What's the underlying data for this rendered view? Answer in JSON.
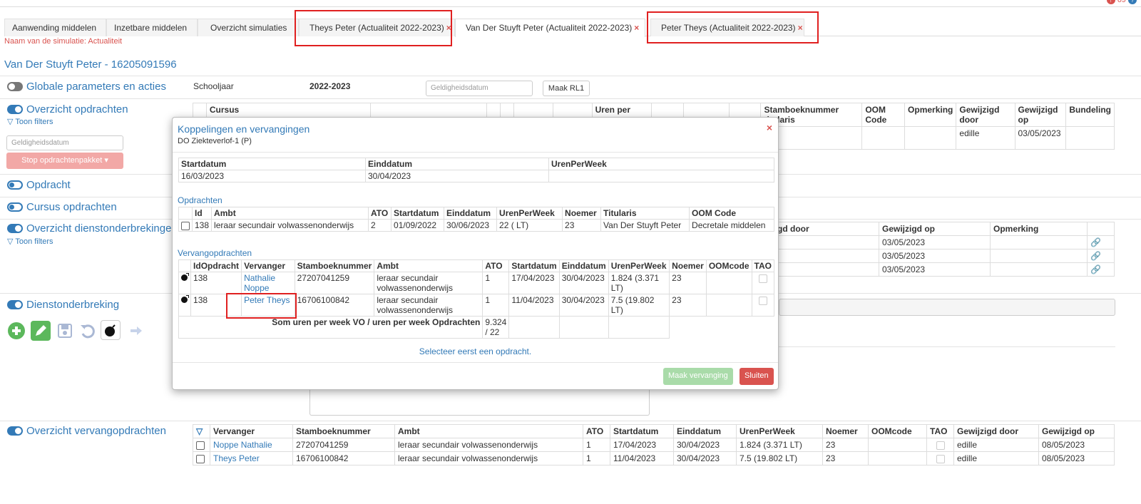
{
  "notifications": {
    "count": "69"
  },
  "tabs": [
    {
      "label": "Aanwending middelen"
    },
    {
      "label": "Inzetbare middelen"
    },
    {
      "label": "Overzicht simulaties"
    },
    {
      "label": "Theys Peter (Actualiteit 2022-2023)",
      "close": "×"
    },
    {
      "label": "Van Der Stuyft Peter (Actualiteit 2022-2023)",
      "close": "×"
    },
    {
      "label": "Peter Theys (Actualiteit 2022-2023)",
      "close": "×"
    }
  ],
  "simulation_name": "Naam van de simulatie: Actualiteit",
  "person_title": "Van Der Stuyft Peter - 16205091596",
  "global": {
    "title": "Globale parameters en acties",
    "schooljaar_label": "Schooljaar",
    "schooljaar_value": "2022-2023",
    "geldigheid_placeholder": "Geldigheidsdatum",
    "maak_rl1": "Maak RL1"
  },
  "overzicht_opdrachten": {
    "title": "Overzicht opdrachten",
    "filters": "Toon filters",
    "geldigheid_placeholder": "Geldigheidsdatum",
    "stop_button": "Stop opdrachtenpakket ▾",
    "headers_left": [
      "Cursus",
      "Uren per"
    ],
    "headers_right": [
      "Stamboeknummer titularis",
      "OOM Code",
      "Opmerking",
      "Gewijzigd door",
      "Gewijzigd op",
      "Bundeling"
    ],
    "row": {
      "gewijzigd_door": "edille",
      "gewijzigd_op": "03/05/2023"
    }
  },
  "opdracht_title": "Opdracht",
  "cursus_title": "Cursus opdrachten",
  "dienstonderbrekingen": {
    "title": "Overzicht dienstonderbrekingen",
    "filters": "Toon filters",
    "headers": [
      "gd door",
      "Gewijzigd op",
      "Opmerking"
    ],
    "rows": [
      {
        "gewijzigd_op": "03/05/2023"
      },
      {
        "gewijzigd_op": "03/05/2023"
      },
      {
        "gewijzigd_op": "03/05/2023"
      }
    ]
  },
  "dienstonderbreking_title": "Dienstonderbreking",
  "vervangopdrachten": {
    "title": "Overzicht vervangopdrachten",
    "headers": [
      "Vervanger",
      "Stamboeknummer",
      "Ambt",
      "ATO",
      "Startdatum",
      "Einddatum",
      "UrenPerWeek",
      "Noemer",
      "OOMcode",
      "TAO",
      "Gewijzigd door",
      "Gewijzigd op"
    ],
    "rows": [
      {
        "vervanger": "Noppe Nathalie",
        "stamboek": "27207041259",
        "ambt": "leraar secundair volwassenonderwijs",
        "ato": "1",
        "start": "17/04/2023",
        "eind": "30/04/2023",
        "uren": "1.824 (3.371 LT)",
        "noemer": "23",
        "oom": "",
        "door": "edille",
        "op": "08/05/2023"
      },
      {
        "vervanger": "Theys Peter",
        "stamboek": "16706100842",
        "ambt": "leraar secundair volwassenonderwijs",
        "ato": "1",
        "start": "11/04/2023",
        "eind": "30/04/2023",
        "uren": "7.5 (19.802 LT)",
        "noemer": "23",
        "oom": "",
        "door": "edille",
        "op": "08/05/2023"
      }
    ]
  },
  "modal": {
    "title": "Koppelingen en vervangingen",
    "subtitle": "DO Ziekteverlof-1 (P)",
    "close": "×",
    "period_headers": [
      "Startdatum",
      "Einddatum",
      "UrenPerWeek"
    ],
    "period_row": {
      "start": "16/03/2023",
      "eind": "30/04/2023",
      "uren": ""
    },
    "opdrachten_label": "Opdrachten",
    "opdrachten_headers": [
      "Id",
      "Ambt",
      "ATO",
      "Startdatum",
      "Einddatum",
      "UrenPerWeek",
      "Noemer",
      "Titularis",
      "OOM Code"
    ],
    "opdrachten_row": {
      "id": "138",
      "ambt": "leraar secundair volwassenonderwijs",
      "ato": "2",
      "start": "01/09/2022",
      "eind": "30/06/2023",
      "uren": "22 ( LT)",
      "noemer": "23",
      "titularis": "Van Der Stuyft Peter",
      "oom": "Decretale middelen"
    },
    "verv_label": "Vervangopdrachten",
    "verv_headers": [
      "IdOpdracht",
      "Vervanger",
      "Stamboeknummer",
      "Ambt",
      "ATO",
      "Startdatum",
      "Einddatum",
      "UrenPerWeek",
      "Noemer",
      "OOMcode",
      "TAO"
    ],
    "verv_rows": [
      {
        "id": "138",
        "vervanger": "Nathalie Noppe",
        "stamboek": "27207041259",
        "ambt": "leraar secundair volwassenonderwijs",
        "ato": "1",
        "start": "17/04/2023",
        "eind": "30/04/2023",
        "uren": "1.824 (3.371 LT)",
        "noemer": "23",
        "oom": ""
      },
      {
        "id": "138",
        "vervanger": "Peter Theys",
        "stamboek": "16706100842",
        "ambt": "leraar secundair volwassenonderwijs",
        "ato": "1",
        "start": "11/04/2023",
        "eind": "30/04/2023",
        "uren": "7.5 (19.802 LT)",
        "noemer": "23",
        "oom": ""
      }
    ],
    "som_label": "Som uren per week VO / uren per week Opdrachten",
    "som_value": "9.324 / 22",
    "select_msg": "Selecteer eerst een opdracht.",
    "maak_vervanging": "Maak vervanging",
    "sluiten": "Sluiten"
  },
  "colors": {
    "accent": "#337ab7",
    "danger": "#d9534f",
    "success": "#5cb85c",
    "highlight": "#e02020"
  }
}
